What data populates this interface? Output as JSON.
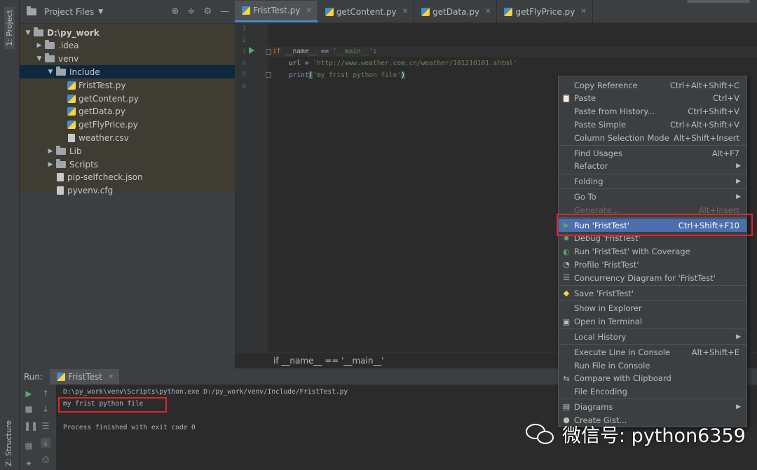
{
  "tool_strip": {
    "project_tab": "1: Project",
    "structure_tab": "Z: Structure"
  },
  "project": {
    "header_title": "Project Files",
    "tree": [
      {
        "label": "D:\\py_work",
        "type": "folder",
        "depth": 0,
        "expanded": true,
        "bold": true
      },
      {
        "label": ".idea",
        "type": "folder",
        "depth": 1,
        "expanded": false
      },
      {
        "label": "venv",
        "type": "folder",
        "depth": 1,
        "expanded": true
      },
      {
        "label": "Include",
        "type": "folder",
        "depth": 2,
        "expanded": true,
        "selected": true
      },
      {
        "label": "FristTest.py",
        "type": "py",
        "depth": 3
      },
      {
        "label": "getContent.py",
        "type": "py",
        "depth": 3
      },
      {
        "label": "getData.py",
        "type": "py",
        "depth": 3
      },
      {
        "label": "getFlyPrice.py",
        "type": "py",
        "depth": 3
      },
      {
        "label": "weather.csv",
        "type": "csv",
        "depth": 3
      },
      {
        "label": "Lib",
        "type": "folder",
        "depth": 2,
        "expanded": false
      },
      {
        "label": "Scripts",
        "type": "folder",
        "depth": 2,
        "expanded": false
      },
      {
        "label": "pip-selfcheck.json",
        "type": "json",
        "depth": 2
      },
      {
        "label": "pyvenv.cfg",
        "type": "cfg",
        "depth": 2
      }
    ]
  },
  "editor_tabs": [
    {
      "label": "FristTest.py",
      "active": true
    },
    {
      "label": "getContent.py",
      "active": false
    },
    {
      "label": "getData.py",
      "active": false
    },
    {
      "label": "getFlyPrice.py",
      "active": false
    }
  ],
  "editor": {
    "line_numbers": [
      "1",
      "2",
      "3",
      "4",
      "5",
      "6"
    ],
    "code": {
      "line3_kw": "if",
      "line3_rest": " __name__ == ",
      "line3_str": "'__main__'",
      "line3_end": ":",
      "line4_pre": "    url = ",
      "line4_str": "'http://www.weather.com.cn/weather/101210101.shtml'",
      "line5_fn": "    print",
      "line5_open": "(",
      "line5_str": "'my frist python file'",
      "line5_close": ")"
    },
    "breadcrumb": "if __name__ == '__main__'"
  },
  "run_panel": {
    "label": "Run:",
    "tab": "FristTest",
    "output": [
      "D:\\py_work\\venv\\Scripts\\python.exe D:/py_work/venv/Include/FristTest.py",
      "my frist python file",
      "",
      "Process finished with exit code 0"
    ]
  },
  "context_menu": {
    "items": [
      {
        "label": "Copy Reference",
        "shortcut": "Ctrl+Alt+Shift+C",
        "icon": ""
      },
      {
        "label": "Paste",
        "shortcut": "Ctrl+V",
        "icon": "clipboard-icon"
      },
      {
        "label": "Paste from History...",
        "shortcut": "Ctrl+Shift+V",
        "icon": ""
      },
      {
        "label": "Paste Simple",
        "shortcut": "Ctrl+Alt+Shift+V",
        "icon": ""
      },
      {
        "label": "Column Selection Mode",
        "shortcut": "Alt+Shift+Insert",
        "icon": ""
      },
      {
        "sep": true
      },
      {
        "label": "Find Usages",
        "shortcut": "Alt+F7",
        "icon": ""
      },
      {
        "label": "Refactor",
        "shortcut": "",
        "submenu": true,
        "icon": ""
      },
      {
        "sep": true
      },
      {
        "label": "Folding",
        "shortcut": "",
        "submenu": true,
        "icon": ""
      },
      {
        "sep": true
      },
      {
        "label": "Go To",
        "shortcut": "",
        "submenu": true,
        "icon": ""
      },
      {
        "label": "Generate...",
        "shortcut": "Alt+Insert",
        "disabled": true,
        "icon": ""
      },
      {
        "sep": true
      },
      {
        "label": "Run 'FristTest'",
        "shortcut": "Ctrl+Shift+F10",
        "selected": true,
        "icon": "run-icon"
      },
      {
        "label": "Debug 'FristTest'",
        "shortcut": "",
        "icon": "debug-icon"
      },
      {
        "label": "Run 'FristTest' with Coverage",
        "shortcut": "",
        "icon": "coverage-icon"
      },
      {
        "label": "Profile 'FristTest'",
        "shortcut": "",
        "icon": "profile-icon"
      },
      {
        "label": "Concurrency Diagram for 'FristTest'",
        "shortcut": "",
        "icon": "concurrency-icon"
      },
      {
        "sep": true
      },
      {
        "label": "Save 'FristTest'",
        "shortcut": "",
        "icon": "python-icon"
      },
      {
        "sep": true
      },
      {
        "label": "Show in Explorer",
        "shortcut": "",
        "icon": ""
      },
      {
        "label": "Open in Terminal",
        "shortcut": "",
        "icon": "terminal-icon"
      },
      {
        "sep": true
      },
      {
        "label": "Local History",
        "shortcut": "",
        "submenu": true,
        "icon": ""
      },
      {
        "sep": true
      },
      {
        "label": "Execute Line in Console",
        "shortcut": "Alt+Shift+E",
        "icon": ""
      },
      {
        "label": "Run File in Console",
        "shortcut": "",
        "icon": ""
      },
      {
        "label": "Compare with Clipboard",
        "shortcut": "",
        "icon": "compare-icon"
      },
      {
        "label": "File Encoding",
        "shortcut": "",
        "icon": ""
      },
      {
        "sep": true
      },
      {
        "label": "Diagrams",
        "shortcut": "",
        "submenu": true,
        "icon": "diagram-icon"
      },
      {
        "label": "Create Gist...",
        "shortcut": "",
        "icon": "github-icon"
      }
    ]
  },
  "watermark": {
    "text": "微信号: python6359"
  },
  "colors": {
    "selection": "#4b6eaf",
    "highlight_box": "#e0242c",
    "run_green": "#59a869"
  }
}
